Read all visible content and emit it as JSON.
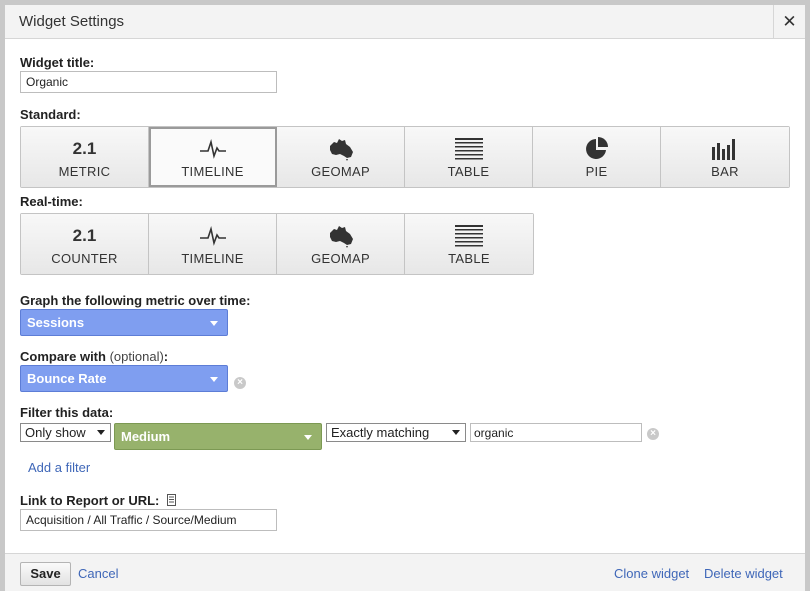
{
  "dialog": {
    "title": "Widget Settings",
    "close_glyph": "✕"
  },
  "widget_title": {
    "label": "Widget title:",
    "value": "Organic"
  },
  "standard": {
    "label": "Standard:",
    "tiles": [
      {
        "label": "METRIC",
        "icon": "2.1",
        "selected": false
      },
      {
        "label": "TIMELINE",
        "icon": "timeline-icon",
        "selected": true
      },
      {
        "label": "GEOMAP",
        "icon": "map-icon",
        "selected": false
      },
      {
        "label": "TABLE",
        "icon": "table-icon",
        "selected": false
      },
      {
        "label": "PIE",
        "icon": "pie-icon",
        "selected": false
      },
      {
        "label": "BAR",
        "icon": "bar-chart-icon",
        "selected": false
      }
    ]
  },
  "realtime": {
    "label": "Real-time:",
    "tiles": [
      {
        "label": "COUNTER",
        "icon": "2.1"
      },
      {
        "label": "TIMELINE",
        "icon": "timeline-icon"
      },
      {
        "label": "GEOMAP",
        "icon": "map-icon"
      },
      {
        "label": "TABLE",
        "icon": "table-icon"
      }
    ]
  },
  "graph_metric": {
    "label": "Graph the following metric over time:",
    "value": "Sessions"
  },
  "compare": {
    "label": "Compare with",
    "optional": "(optional)",
    "suffix": ":",
    "value": "Bounce Rate"
  },
  "filter": {
    "label": "Filter this data:",
    "mode": "Only show",
    "dimension": "Medium",
    "match": "Exactly matching",
    "value": "organic",
    "add_label": "Add a filter"
  },
  "link": {
    "label": "Link to Report or URL:",
    "value": "Acquisition / All Traffic / Source/Medium"
  },
  "footer": {
    "save": "Save",
    "cancel": "Cancel",
    "clone": "Clone widget",
    "delete": "Delete widget"
  },
  "colors": {
    "metric_select": "#7f9ef0",
    "dimension_select": "#97b26c",
    "link": "#3f67b8"
  }
}
